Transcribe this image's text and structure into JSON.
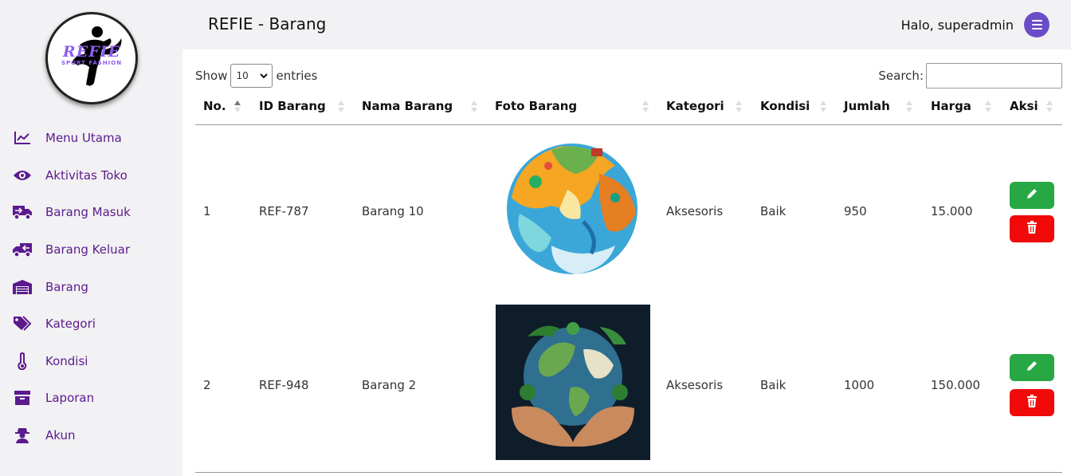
{
  "brand": {
    "logo_text": "REFIE",
    "logo_subtext": "SPORT FASHION"
  },
  "sidebar": {
    "items": [
      {
        "label": "Menu Utama",
        "icon": "chart-line-icon"
      },
      {
        "label": "Aktivitas Toko",
        "icon": "eye-icon"
      },
      {
        "label": "Barang Masuk",
        "icon": "truck-in-icon"
      },
      {
        "label": "Barang Keluar",
        "icon": "truck-out-icon"
      },
      {
        "label": "Barang",
        "icon": "warehouse-icon"
      },
      {
        "label": "Kategori",
        "icon": "tags-icon"
      },
      {
        "label": "Kondisi",
        "icon": "thermometer-icon"
      },
      {
        "label": "Laporan",
        "icon": "archive-icon"
      },
      {
        "label": "Akun",
        "icon": "user-secret-icon"
      }
    ]
  },
  "header": {
    "title": "REFIE - Barang",
    "greeting": "Halo, superadmin",
    "menu_icon": "hamburger-icon"
  },
  "table_controls": {
    "show_label": "Show",
    "entries_value": "10",
    "entries_label": "entries",
    "search_label": "Search:",
    "search_value": ""
  },
  "table": {
    "columns": [
      "No.",
      "ID Barang",
      "Nama Barang",
      "Foto Barang",
      "Kategori",
      "Kondisi",
      "Jumlah",
      "Harga",
      "Aksi"
    ],
    "rows": [
      {
        "no": "1",
        "id": "REF-787",
        "nama": "Barang 10",
        "foto": "colorful-globe-illustration",
        "kategori": "Aksesoris",
        "kondisi": "Baik",
        "jumlah": "950",
        "harga": "15.000"
      },
      {
        "no": "2",
        "id": "REF-948",
        "nama": "Barang 2",
        "foto": "globe-in-hands-illustration",
        "kategori": "Aksesoris",
        "kondisi": "Baik",
        "jumlah": "1000",
        "harga": "150.000"
      }
    ]
  },
  "colors": {
    "accent": "#5b1a8e",
    "menu_button": "#6b4cc7",
    "edit_button": "#27a844",
    "delete_button": "#f00a0a"
  }
}
